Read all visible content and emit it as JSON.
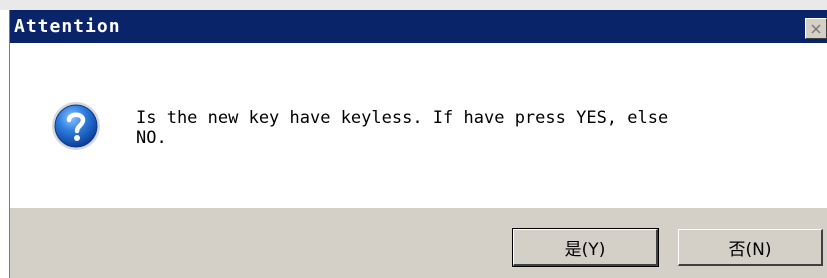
{
  "window": {
    "title": "Attention",
    "close_symbol": "×"
  },
  "dialog": {
    "icon": "question-icon",
    "message": "Is the new key have keyless. If have press YES, else\nNO."
  },
  "buttons": {
    "yes_label": "是(Y)",
    "no_label": "否(N)"
  },
  "colors": {
    "titlebar": "#0a246a",
    "button_face": "#d4d0c8",
    "icon_blue": "#1f6fd1"
  }
}
